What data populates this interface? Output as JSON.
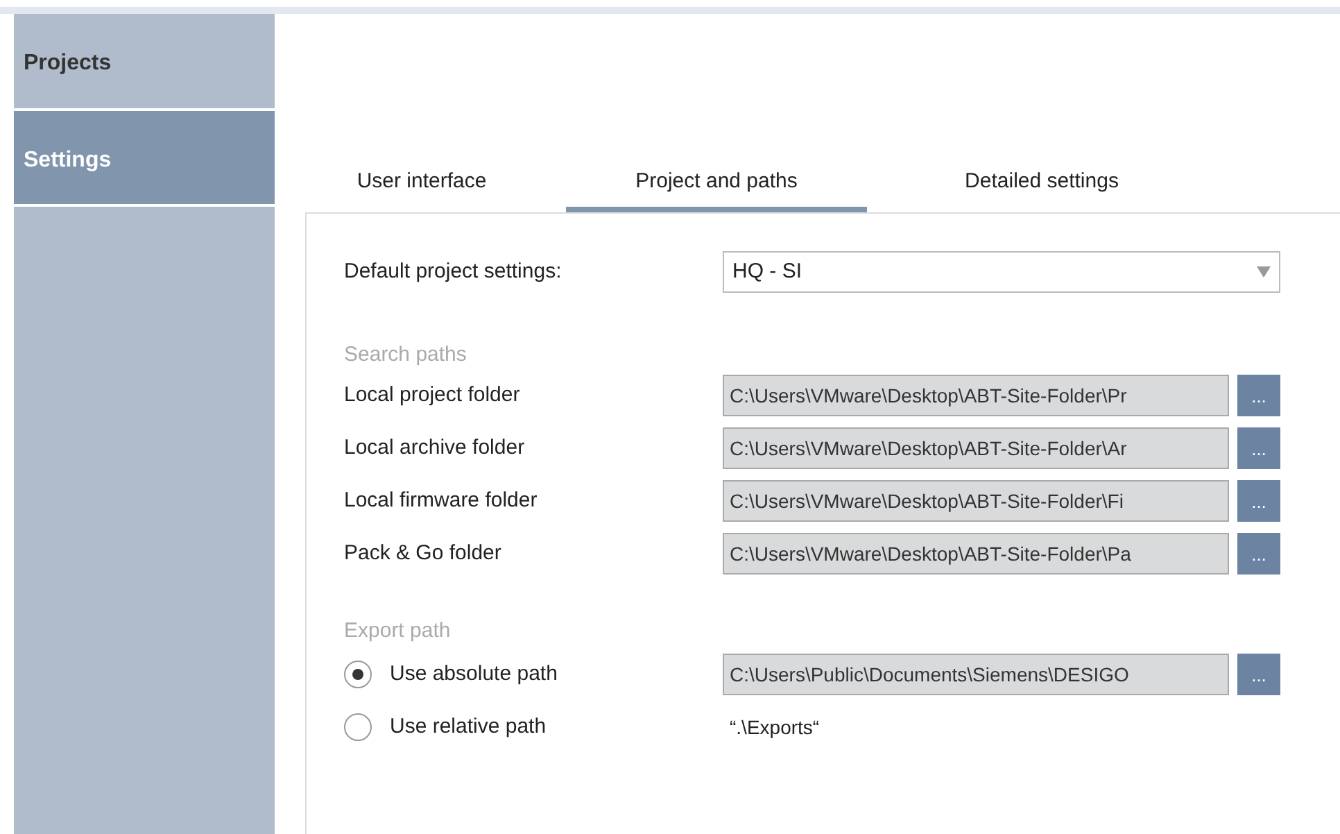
{
  "sidebar": {
    "items": [
      {
        "label": "Projects",
        "selected": false
      },
      {
        "label": "Settings",
        "selected": true
      }
    ]
  },
  "tabs": [
    {
      "label": "User interface",
      "selected": false
    },
    {
      "label": "Project and paths",
      "selected": true
    },
    {
      "label": "Detailed settings",
      "selected": false
    }
  ],
  "default_project_settings": {
    "label": "Default project settings:",
    "value": "HQ - SI"
  },
  "search_paths": {
    "heading": "Search paths",
    "rows": [
      {
        "label": "Local project folder",
        "value": "C:\\Users\\VMware\\Desktop\\ABT-Site-Folder\\Pr",
        "button": "..."
      },
      {
        "label": "Local archive folder",
        "value": "C:\\Users\\VMware\\Desktop\\ABT-Site-Folder\\Ar",
        "button": "..."
      },
      {
        "label": "Local firmware folder",
        "value": "C:\\Users\\VMware\\Desktop\\ABT-Site-Folder\\Fi",
        "button": "..."
      },
      {
        "label": "Pack & Go folder",
        "value": "C:\\Users\\VMware\\Desktop\\ABT-Site-Folder\\Pa",
        "button": "..."
      }
    ]
  },
  "export_path": {
    "heading": "Export path",
    "options": [
      {
        "label": "Use absolute path",
        "selected": true,
        "kind": "field",
        "value": "C:\\Users\\Public\\Documents\\Siemens\\DESIGO",
        "button": "..."
      },
      {
        "label": "Use relative path",
        "selected": false,
        "kind": "text",
        "value": "“.\\Exports“"
      }
    ]
  }
}
